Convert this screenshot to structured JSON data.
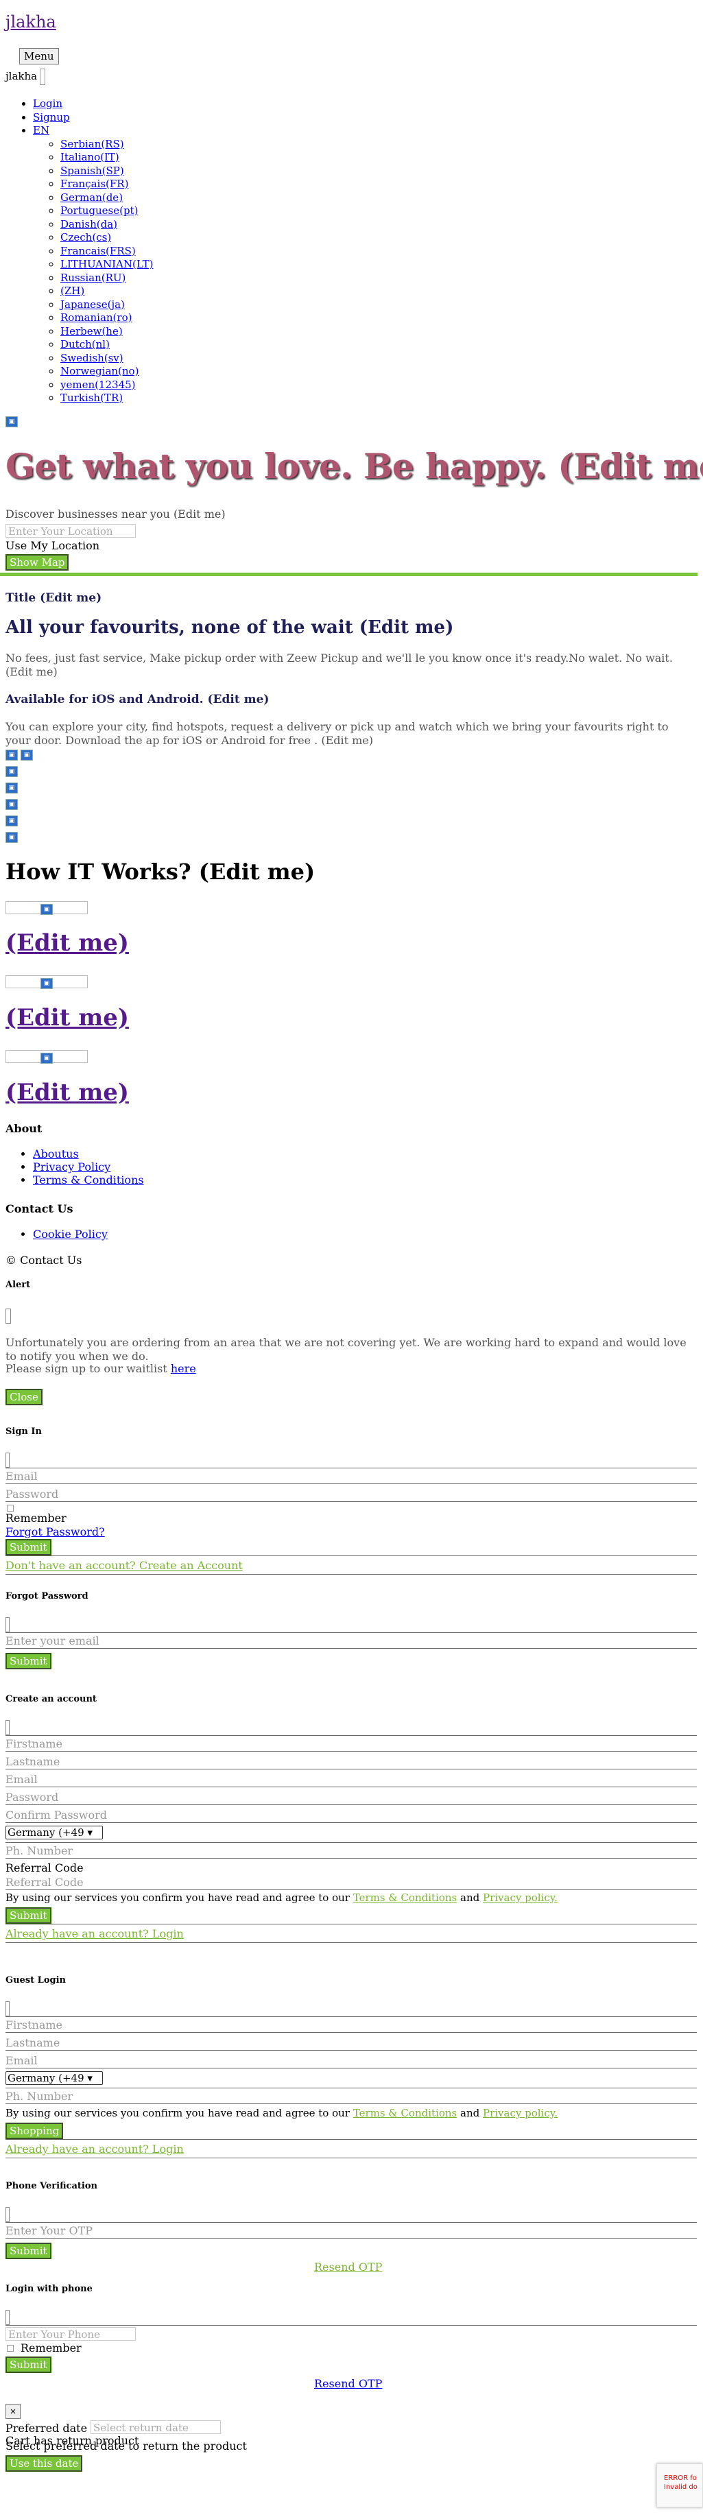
{
  "header": {
    "brand": "jlakha",
    "menu_label": "Menu",
    "user_name": "jlakha"
  },
  "nav": {
    "items": [
      "Login",
      "Signup",
      "EN"
    ],
    "languages": [
      " Serbian(RS)",
      "Italiano(IT)",
      "Spanish(SP)",
      "Français(FR)",
      "German(de)",
      "Portuguese(pt)",
      "Danish(da)",
      "Czech(cs)",
      "Francais(FRS)",
      "LITHUANIAN(LT)",
      "Russian(RU)",
      "(ZH)",
      "Japanese(ja)",
      "Romanian(ro)",
      "Herbew(he)",
      "Dutch(nl)",
      "Swedish(sv)",
      "Norwegian(no)",
      "yemen(12345)",
      "Turkish(TR)"
    ]
  },
  "hero": {
    "title": "Get what you love. Be happy. (Edit me)",
    "subtitle": "Discover businesses near you (Edit me)",
    "location_placeholder": "Enter Your Location",
    "use_location": "Use My Location",
    "show_map": "Show Map"
  },
  "promo": {
    "title": "Title (Edit me)",
    "heading": "All your favourits, none of the wait (Edit me)",
    "text": "No fees, just fast service, Make pickup order with Zeew Pickup and we'll le you know once it's ready.No walet. No wait. (Edit me)",
    "availability": "Available for iOS and Android. (Edit me)",
    "availability_text": "You can explore your city, find hotspots, request a delivery or pick up and watch which we bring your favourits right to your door. Download the ap for iOS or Android for free . (Edit me)"
  },
  "how": {
    "title": "How IT Works? (Edit me)",
    "steps": [
      "(Edit me)",
      "(Edit me)",
      "(Edit me)"
    ]
  },
  "footer": {
    "about_title": "About",
    "about_links": [
      "Aboutus",
      "Privacy Policy",
      "Terms & Conditions"
    ],
    "contact_title": "Contact Us",
    "contact_links": [
      "Cookie Policy"
    ],
    "copyright": "© Contact Us"
  },
  "alert_modal": {
    "title": "Alert",
    "message": "Unfortunately you are ordering from an area that we are not covering yet. We are working hard to expand and would love to notify you when we do.",
    "waitlist_prefix": "Please sign up to our waitlist",
    "waitlist_link": "here",
    "close": "Close"
  },
  "signin_modal": {
    "title": "Sign In",
    "email_placeholder": "Email",
    "password_placeholder": "Password",
    "remember": "Remember",
    "forgot": "Forgot Password?",
    "submit": "Submit",
    "create_link": "Don't have an account? Create an Account"
  },
  "forgot_modal": {
    "title": "Forgot Password",
    "email_placeholder": "Enter your email",
    "submit": "Submit"
  },
  "create_modal": {
    "title": "Create an account",
    "firstname": "Firstname",
    "lastname": "Lastname",
    "email": "Email",
    "password": "Password",
    "confirm": "Confirm Password",
    "country": "Germany (+49",
    "phone": "Ph. Number",
    "referral_label": "Referral Code",
    "referral_placeholder": "Referral Code",
    "terms_prefix": "By using our services you confirm you have read and agree to our",
    "terms_link": "Terms & Conditions",
    "and": "and",
    "privacy_link": "Privacy policy.",
    "submit": "Submit",
    "login_link": "Already have an account? Login"
  },
  "guest_modal": {
    "title": "Guest Login",
    "firstname": "Firstname",
    "lastname": "Lastname",
    "email": "Email",
    "country": "Germany (+49",
    "phone": "Ph. Number",
    "terms_prefix": "By using our services you confirm you have read and agree to our",
    "terms_link": "Terms & Conditions",
    "and": "and",
    "privacy_link": "Privacy policy.",
    "submit": "Shopping",
    "login_link": "Already have an account? Login"
  },
  "otp_modal": {
    "title": "Phone Verification",
    "otp_placeholder": "Enter Your OTP",
    "submit": "Submit",
    "resend": "Resend OTP"
  },
  "phone_modal": {
    "title": "Login with phone",
    "phone_placeholder": "Enter Your Phone",
    "remember": "Remember",
    "submit": "Submit",
    "resend": "Resend OTP"
  },
  "return_modal": {
    "close": "×",
    "preferred_label": "Preferred date",
    "date_placeholder": "Select return date",
    "cart_text": "Cart has return product",
    "select_text": "Select preferred date to return the product",
    "use_date": "Use this date"
  },
  "recaptcha": {
    "error_line1": "ERROR fo",
    "error_line2": "Invalid do"
  },
  "colors": {
    "accent_green": "#7ac43a",
    "hero_title": "#b05570",
    "heading_navy": "#1f1f5a"
  }
}
